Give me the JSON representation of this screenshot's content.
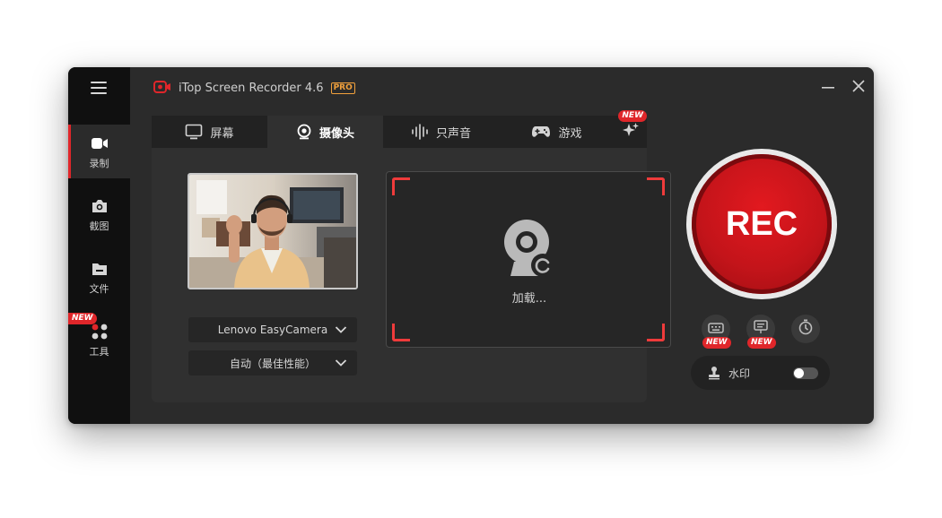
{
  "app": {
    "title": "iTop Screen Recorder 4.6",
    "badge": "PRO",
    "accent_color": "#e0262a"
  },
  "sidebar": {
    "menu_icon": "hamburger-menu-icon",
    "items": [
      {
        "label": "录制",
        "icon": "camera-video-icon",
        "active": true
      },
      {
        "label": "截图",
        "icon": "photo-camera-icon",
        "active": false
      },
      {
        "label": "文件",
        "icon": "folder-icon",
        "active": false
      },
      {
        "label": "工具",
        "icon": "grid-tools-icon",
        "active": false,
        "badge": "NEW"
      }
    ]
  },
  "tabs": [
    {
      "label": "屏幕",
      "icon": "monitor-icon",
      "active": false
    },
    {
      "label": "摄像头",
      "icon": "webcam-icon",
      "active": true
    },
    {
      "label": "只声音",
      "icon": "audio-wave-icon",
      "active": false
    },
    {
      "label": "游戏",
      "icon": "gamepad-icon",
      "active": false
    },
    {
      "label": "",
      "icon": "sparkle-icon",
      "badge": "NEW"
    }
  ],
  "camera": {
    "device": "Lenovo EasyCamera",
    "quality": "自动（最佳性能）",
    "loading_text": "加载..."
  },
  "rec": {
    "label": "REC"
  },
  "tools": [
    {
      "icon": "keyboard-icon",
      "badge": "NEW"
    },
    {
      "icon": "presentation-icon",
      "badge": "NEW"
    },
    {
      "icon": "timer-icon",
      "badge": ""
    }
  ],
  "watermark": {
    "label": "水印",
    "icon": "stamp-icon",
    "enabled": false
  }
}
